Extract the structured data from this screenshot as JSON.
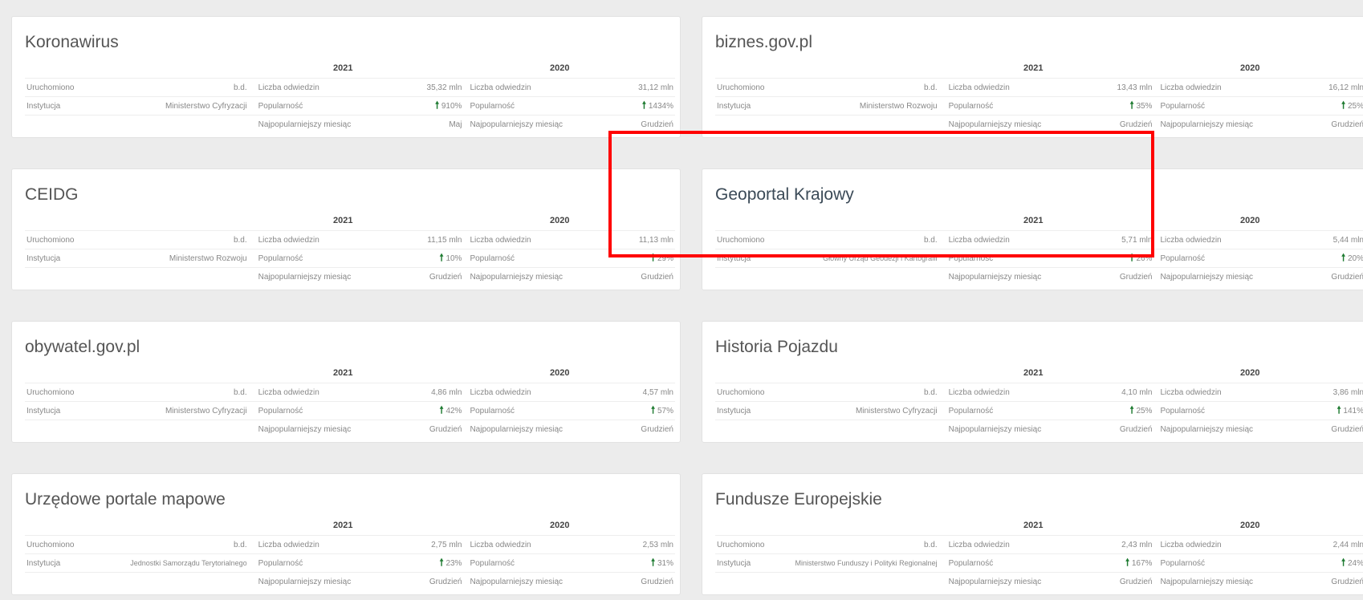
{
  "cards": [
    {
      "title": "Koronawirus",
      "year1": "2021",
      "year2": "2020",
      "rows": [
        {
          "label": "Uruchomiono",
          "value": "b.d.",
          "m1": "Liczba odwiedzin",
          "v1": "35,32 mln",
          "m2": "Liczba odwiedzin",
          "v2": "31,12 mln"
        },
        {
          "label": "Instytucja",
          "value": "Ministerstwo Cyfryzacji",
          "m1": "Popularność",
          "v1": "910%",
          "m2": "Popularność",
          "v2": "1434%"
        },
        {
          "label": "",
          "value": "",
          "m1": "Najpopularniejszy miesiąc",
          "v1": "Maj",
          "m2": "Najpopularniejszy miesiąc",
          "v2": "Grudzień"
        }
      ]
    },
    {
      "title": "biznes.gov.pl",
      "year1": "2021",
      "year2": "2020",
      "rows": [
        {
          "label": "Uruchomiono",
          "value": "b.d.",
          "m1": "Liczba odwiedzin",
          "v1": "13,43 mln",
          "m2": "Liczba odwiedzin",
          "v2": "16,12 mln"
        },
        {
          "label": "Instytucja",
          "value": "Ministerstwo Rozwoju",
          "m1": "Popularność",
          "v1": "35%",
          "m2": "Popularność",
          "v2": "25%"
        },
        {
          "label": "",
          "value": "",
          "m1": "Najpopularniejszy miesiąc",
          "v1": "Grudzień",
          "m2": "Najpopularniejszy miesiąc",
          "v2": "Grudzień"
        }
      ]
    },
    {
      "title": "CEIDG",
      "year1": "2021",
      "year2": "2020",
      "rows": [
        {
          "label": "Uruchomiono",
          "value": "b.d.",
          "m1": "Liczba odwiedzin",
          "v1": "11,15 mln",
          "m2": "Liczba odwiedzin",
          "v2": "11,13 mln"
        },
        {
          "label": "Instytucja",
          "value": "Ministerstwo Rozwoju",
          "m1": "Popularność",
          "v1": "10%",
          "m2": "Popularność",
          "v2": "29%"
        },
        {
          "label": "",
          "value": "",
          "m1": "Najpopularniejszy miesiąc",
          "v1": "Grudzień",
          "m2": "Najpopularniejszy miesiąc",
          "v2": "Grudzień"
        }
      ]
    },
    {
      "title": "Geoportal Krajowy",
      "year1": "2021",
      "year2": "2020",
      "rows": [
        {
          "label": "Uruchomiono",
          "value": "b.d.",
          "m1": "Liczba odwiedzin",
          "v1": "5,71 mln",
          "m2": "Liczba odwiedzin",
          "v2": "5,44 mln"
        },
        {
          "label": "Instytucja",
          "value": "Główny Urząd Geodezji i Kartografii",
          "m1": "Popularność",
          "v1": "26%",
          "m2": "Popularność",
          "v2": "20%"
        },
        {
          "label": "",
          "value": "",
          "m1": "Najpopularniejszy miesiąc",
          "v1": "Grudzień",
          "m2": "Najpopularniejszy miesiąc",
          "v2": "Grudzień"
        }
      ]
    },
    {
      "title": "obywatel.gov.pl",
      "year1": "2021",
      "year2": "2020",
      "rows": [
        {
          "label": "Uruchomiono",
          "value": "b.d.",
          "m1": "Liczba odwiedzin",
          "v1": "4,86 mln",
          "m2": "Liczba odwiedzin",
          "v2": "4,57 mln"
        },
        {
          "label": "Instytucja",
          "value": "Ministerstwo Cyfryzacji",
          "m1": "Popularność",
          "v1": "42%",
          "m2": "Popularność",
          "v2": "57%"
        },
        {
          "label": "",
          "value": "",
          "m1": "Najpopularniejszy miesiąc",
          "v1": "Grudzień",
          "m2": "Najpopularniejszy miesiąc",
          "v2": "Grudzień"
        }
      ]
    },
    {
      "title": "Historia Pojazdu",
      "year1": "2021",
      "year2": "2020",
      "rows": [
        {
          "label": "Uruchomiono",
          "value": "b.d.",
          "m1": "Liczba odwiedzin",
          "v1": "4,10 mln",
          "m2": "Liczba odwiedzin",
          "v2": "3,86 mln"
        },
        {
          "label": "Instytucja",
          "value": "Ministerstwo Cyfryzacji",
          "m1": "Popularność",
          "v1": "25%",
          "m2": "Popularność",
          "v2": "141%"
        },
        {
          "label": "",
          "value": "",
          "m1": "Najpopularniejszy miesiąc",
          "v1": "Grudzień",
          "m2": "Najpopularniejszy miesiąc",
          "v2": "Grudzień"
        }
      ]
    },
    {
      "title": "Urzędowe portale mapowe",
      "year1": "2021",
      "year2": "2020",
      "rows": [
        {
          "label": "Uruchomiono",
          "value": "b.d.",
          "m1": "Liczba odwiedzin",
          "v1": "2,75 mln",
          "m2": "Liczba odwiedzin",
          "v2": "2,53 mln"
        },
        {
          "label": "Instytucja",
          "value": "Jednostki Samorządu Terytorialnego",
          "m1": "Popularność",
          "v1": "23%",
          "m2": "Popularność",
          "v2": "31%"
        },
        {
          "label": "",
          "value": "",
          "m1": "Najpopularniejszy miesiąc",
          "v1": "Grudzień",
          "m2": "Najpopularniejszy miesiąc",
          "v2": "Grudzień"
        }
      ]
    },
    {
      "title": "Fundusze Europejskie",
      "year1": "2021",
      "year2": "2020",
      "rows": [
        {
          "label": "Uruchomiono",
          "value": "b.d.",
          "m1": "Liczba odwiedzin",
          "v1": "2,43 mln",
          "m2": "Liczba odwiedzin",
          "v2": "2,44 mln"
        },
        {
          "label": "Instytucja",
          "value": "Ministerstwo Funduszy i Polityki Regionalnej",
          "m1": "Popularność",
          "v1": "167%",
          "m2": "Popularność",
          "v2": "24%"
        },
        {
          "label": "",
          "value": "",
          "m1": "Najpopularniejszy miesiąc",
          "v1": "Grudzień",
          "m2": "Najpopularniejszy miesiąc",
          "v2": "Grudzień"
        }
      ]
    }
  ]
}
